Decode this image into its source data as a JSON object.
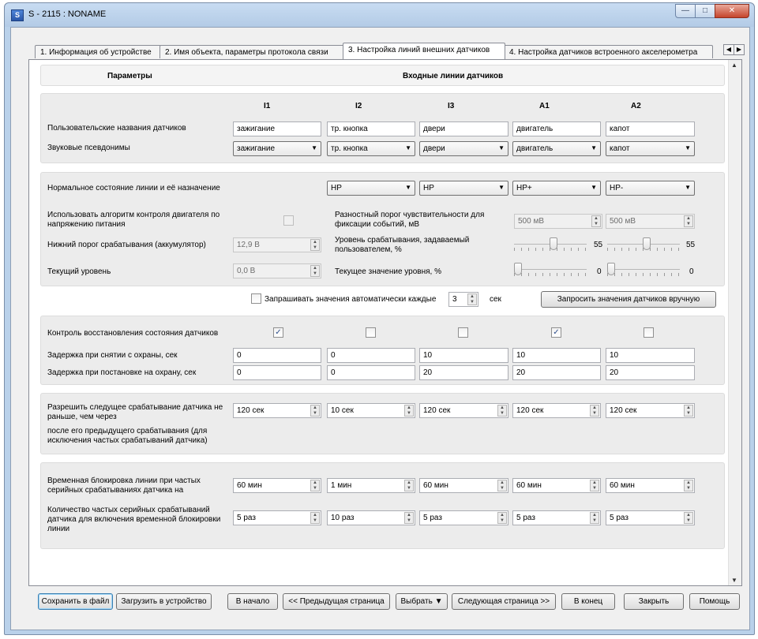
{
  "window": {
    "title": "S - 2115 : NONAME",
    "controls": {
      "minimize": "—",
      "maximize": "□",
      "close": "✕"
    }
  },
  "tabs": [
    {
      "label": "1. Информация об устройстве"
    },
    {
      "label": "2. Имя объекта, параметры протокола связи"
    },
    {
      "label": "3. Настройка линий внешних датчиков",
      "active": true
    },
    {
      "label": "4. Настройка датчиков встроенного акселерометра"
    }
  ],
  "header": {
    "params": "Параметры",
    "inputs": "Входные линии датчиков"
  },
  "columns": [
    "I1",
    "I2",
    "I3",
    "A1",
    "A2"
  ],
  "user_names": {
    "label": "Пользовательские названия датчиков",
    "values": [
      "зажигание",
      "тр. кнопка",
      "двери",
      "двигатель",
      "капот"
    ]
  },
  "sound_aliases": {
    "label": "Звуковые псевдонимы",
    "values": [
      "зажигание",
      "тр. кнопка",
      "двери",
      "двигатель",
      "капот"
    ]
  },
  "normal_state": {
    "label": "Нормальное состояние линии и её назначение",
    "values": [
      "НР",
      "НР",
      "НР+",
      "НР-"
    ]
  },
  "engine_algo": {
    "label": "Использовать алгоритм контроля двигателя по напряжению питания",
    "checked": false
  },
  "lower_threshold": {
    "label": "Нижний порог срабатывания (аккумулятор)",
    "value": "12,9  В"
  },
  "current_level": {
    "label": "Текущий уровень",
    "value": "0,0  В"
  },
  "diff_threshold": {
    "label": "Разностный порог чувствительности для фиксации событий, мВ",
    "values": [
      "500 мВ",
      "500 мВ"
    ]
  },
  "trigger_level": {
    "label": "Уровень срабатывания, задаваемый пользователем, %",
    "values": [
      55,
      55
    ]
  },
  "current_value": {
    "label": "Текущее значение уровня, %",
    "values": [
      0,
      0
    ]
  },
  "auto_request": {
    "label": "Запрашивать значения автоматически каждые",
    "value": "3",
    "unit": "сек",
    "checked": false,
    "manual_button": "Запросить значения датчиков вручную"
  },
  "restore_control": {
    "label": "Контроль восстановления состояния датчиков",
    "checked": [
      true,
      false,
      false,
      true,
      false
    ]
  },
  "disarm_delay": {
    "label": "Задержка при снятии с охраны, сек",
    "values": [
      "0",
      "0",
      "10",
      "10",
      "10"
    ]
  },
  "arm_delay": {
    "label": "Задержка при постановке на охрану, сек",
    "values": [
      "0",
      "0",
      "20",
      "20",
      "20"
    ]
  },
  "next_trigger": {
    "label": "Разрешить следущее срабатывание датчика не раньше, чем через",
    "label2": "после его предыдущего срабатывания (для исключения частых срабатываний датчика)",
    "values": [
      "120  сек",
      "10  сек",
      "120  сек",
      "120  сек",
      "120  сек"
    ]
  },
  "temp_block": {
    "label": "Временная блокировка линии при частых серийных срабатываниях датчика на",
    "values": [
      "60  мин",
      "1  мин",
      "60  мин",
      "60  мин",
      "60  мин"
    ]
  },
  "serial_count": {
    "label": "Количество частых серийных срабатываний датчика для включения временной блокировки линии",
    "values": [
      "5  раз",
      "10  раз",
      "5  раз",
      "5  раз",
      "5  раз"
    ]
  },
  "buttons": {
    "save_file": "Сохранить в файл",
    "load_device": "Загрузить в устройство",
    "to_start": "В начало",
    "prev_page": "<< Предыдущая страница",
    "select": "Выбрать",
    "next_page": "Следующая страница >>",
    "to_end": "В конец",
    "close": "Закрыть",
    "help": "Помощь"
  }
}
